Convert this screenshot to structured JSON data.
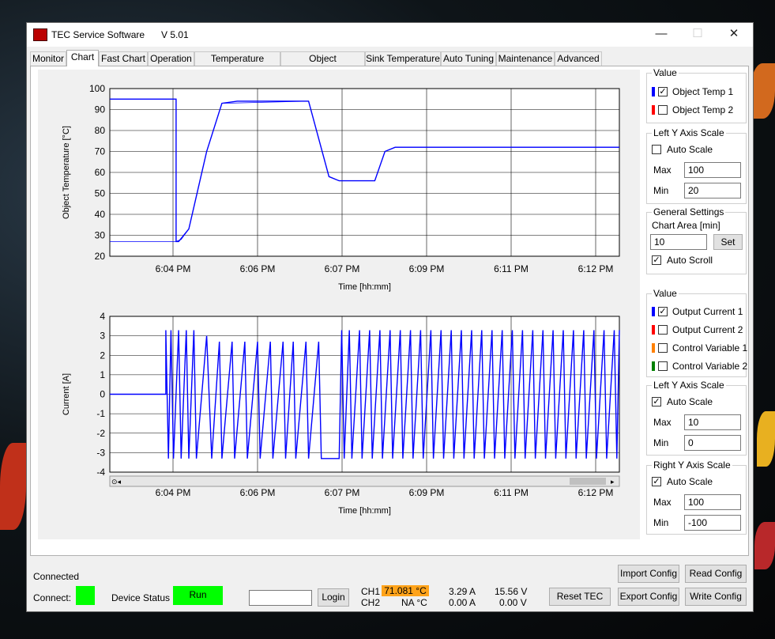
{
  "window": {
    "title": "TEC Service Software",
    "version": "V 5.01"
  },
  "tabs": [
    "Monitor",
    "Chart",
    "Fast Chart",
    "Operation",
    "Temperature Control",
    "Object Temperature",
    "Sink Temperature",
    "Auto Tuning",
    "Maintenance",
    "Advanced"
  ],
  "active_tab": "Chart",
  "panel_top": {
    "value_title": "Value",
    "series": [
      {
        "label": "Object Temp 1",
        "color": "#0000ff",
        "checked": true
      },
      {
        "label": "Object Temp 2",
        "color": "#ff0000",
        "checked": false
      }
    ],
    "left_axis": {
      "title": "Left Y Axis Scale",
      "auto_label": "Auto Scale",
      "auto": false,
      "max_label": "Max",
      "max": "100",
      "min_label": "Min",
      "min": "20"
    },
    "general": {
      "title": "General Settings",
      "area_label": "Chart Area [min]",
      "area": "10",
      "set_label": "Set",
      "autoscroll_label": "Auto Scroll",
      "autoscroll": true
    }
  },
  "panel_bottom": {
    "value_title": "Value",
    "series": [
      {
        "label": "Output Current 1",
        "color": "#0000ff",
        "checked": true
      },
      {
        "label": "Output Current 2",
        "color": "#ff0000",
        "checked": false
      },
      {
        "label": "Control Variable 1",
        "color": "#ff8000",
        "checked": false
      },
      {
        "label": "Control Variable 2",
        "color": "#008000",
        "checked": false
      }
    ],
    "left_axis": {
      "title": "Left Y Axis Scale",
      "auto_label": "Auto Scale",
      "auto": true,
      "max_label": "Max",
      "max": "10",
      "min_label": "Min",
      "min": "0"
    },
    "right_axis": {
      "title": "Right Y Axis Scale",
      "auto_label": "Auto Scale",
      "auto": true,
      "max_label": "Max",
      "max": "100",
      "min_label": "Min",
      "min": "-100"
    }
  },
  "status": {
    "connected": "Connected",
    "connect_label": "Connect:",
    "device_status_label": "Device Status",
    "device_status": "Run",
    "login_label": "Login",
    "ch1": "CH1",
    "ch1_temp": "71.081 °C",
    "ch1_current": "3.29 A",
    "ch1_voltage": "15.56 V",
    "ch2": "CH2",
    "ch2_temp": "NA °C",
    "ch2_current": "0.00 A",
    "ch2_voltage": "0.00 V",
    "buttons": {
      "reset": "Reset TEC",
      "import": "Import Config",
      "export": "Export Config",
      "read": "Read Config",
      "write": "Write Config"
    }
  },
  "chart_data": [
    {
      "type": "line",
      "title": "",
      "xlabel": "Time [hh:mm]",
      "ylabel": "Object Temperature [°C]",
      "x_ticks": [
        "6:04 PM",
        "6:06 PM",
        "6:07 PM",
        "6:09 PM",
        "6:11 PM",
        "6:12 PM"
      ],
      "y_ticks": [
        20,
        30,
        40,
        50,
        60,
        70,
        80,
        90,
        100
      ],
      "ylim": [
        20,
        100
      ],
      "xlim": [
        0,
        10
      ],
      "series": [
        {
          "color": "#0000ff",
          "points": [
            [
              0,
              95
            ],
            [
              1.3,
              95
            ],
            [
              1.3,
              27
            ],
            [
              1.35,
              27
            ],
            [
              1.55,
              33
            ],
            [
              1.9,
              70
            ],
            [
              2.2,
              93
            ],
            [
              2.5,
              94
            ],
            [
              3.0,
              94
            ],
            [
              3.5,
              94
            ],
            [
              3.9,
              94
            ],
            [
              4.3,
              58
            ],
            [
              4.5,
              56
            ],
            [
              4.9,
              56
            ],
            [
              5.2,
              56
            ],
            [
              5.4,
              70
            ],
            [
              5.6,
              72
            ],
            [
              6.5,
              72
            ],
            [
              7.5,
              72
            ],
            [
              8.5,
              72
            ],
            [
              9.5,
              72
            ],
            [
              10,
              72
            ]
          ]
        },
        {
          "color": "#0000ff",
          "points": [
            [
              0,
              27
            ],
            [
              1.3,
              27
            ],
            [
              1.4,
              28
            ],
            [
              1.55,
              33
            ],
            [
              1.9,
              70
            ],
            [
              2.2,
              93
            ],
            [
              3.9,
              94
            ],
            [
              4.3,
              58
            ],
            [
              4.5,
              56
            ],
            [
              5.2,
              56
            ],
            [
              5.4,
              70
            ],
            [
              5.6,
              72
            ],
            [
              10,
              72
            ]
          ]
        }
      ]
    },
    {
      "type": "line",
      "title": "",
      "xlabel": "Time [hh:mm]",
      "ylabel": "Current [A]",
      "x_ticks": [
        "6:04 PM",
        "6:06 PM",
        "6:07 PM",
        "6:09 PM",
        "6:11 PM",
        "6:12 PM"
      ],
      "y_ticks": [
        4,
        3,
        2,
        1,
        0,
        -1,
        -2,
        -3,
        -4
      ],
      "ylim": [
        -4,
        4
      ],
      "xlim": [
        0,
        10
      ],
      "series": [
        {
          "color": "#0000ff",
          "points": [
            [
              0,
              0
            ],
            [
              1.1,
              0
            ],
            [
              1.1,
              3.29
            ],
            [
              1.15,
              -3.3
            ],
            [
              1.2,
              3.29
            ],
            [
              1.25,
              -3.3
            ],
            [
              1.35,
              3.29
            ],
            [
              1.4,
              -3.3
            ],
            [
              1.5,
              3.29
            ],
            [
              1.55,
              -3.3
            ],
            [
              1.65,
              3.29
            ],
            [
              1.7,
              -3.3
            ],
            [
              1.9,
              3.0
            ],
            [
              2.0,
              -3.3
            ],
            [
              2.15,
              2.7
            ],
            [
              2.2,
              -3.3
            ],
            [
              2.4,
              2.7
            ],
            [
              2.45,
              -3.3
            ],
            [
              2.65,
              2.7
            ],
            [
              2.7,
              -3.3
            ],
            [
              2.9,
              2.7
            ],
            [
              2.95,
              -3.3
            ],
            [
              3.15,
              2.7
            ],
            [
              3.2,
              -3.3
            ],
            [
              3.4,
              2.7
            ],
            [
              3.45,
              -3.3
            ],
            [
              3.6,
              2.7
            ],
            [
              3.65,
              -3.3
            ],
            [
              3.85,
              2.7
            ],
            [
              3.9,
              -3.3
            ],
            [
              4.1,
              2.7
            ],
            [
              4.15,
              -3.3
            ],
            [
              4.5,
              -3.3
            ],
            [
              4.55,
              3.29
            ],
            [
              4.6,
              -3.3
            ],
            [
              4.7,
              3.29
            ],
            [
              4.75,
              -3.3
            ],
            [
              4.9,
              3.29
            ],
            [
              4.95,
              -3.3
            ],
            [
              5.1,
              3.29
            ],
            [
              5.15,
              -3.3
            ],
            [
              5.3,
              3.29
            ],
            [
              5.35,
              -3.3
            ],
            [
              5.5,
              3.29
            ],
            [
              5.55,
              -3.3
            ],
            [
              5.7,
              3.29
            ],
            [
              5.75,
              -3.3
            ],
            [
              5.9,
              3.29
            ],
            [
              5.95,
              -3.3
            ],
            [
              6.1,
              3.29
            ],
            [
              6.15,
              -3.3
            ],
            [
              6.3,
              3.29
            ],
            [
              6.35,
              -3.3
            ],
            [
              6.5,
              3.29
            ],
            [
              6.55,
              -3.3
            ],
            [
              6.7,
              3.29
            ],
            [
              6.75,
              -3.3
            ],
            [
              6.9,
              3.29
            ],
            [
              6.95,
              -3.3
            ],
            [
              7.1,
              3.29
            ],
            [
              7.15,
              -3.3
            ],
            [
              7.3,
              3.29
            ],
            [
              7.35,
              -3.3
            ],
            [
              7.5,
              3.29
            ],
            [
              7.55,
              -3.3
            ],
            [
              7.7,
              3.29
            ],
            [
              7.75,
              -3.3
            ],
            [
              7.9,
              3.29
            ],
            [
              7.95,
              -3.3
            ],
            [
              8.1,
              3.29
            ],
            [
              8.15,
              -3.3
            ],
            [
              8.3,
              3.29
            ],
            [
              8.35,
              -3.3
            ],
            [
              8.5,
              3.29
            ],
            [
              8.55,
              -3.3
            ],
            [
              8.7,
              3.29
            ],
            [
              8.75,
              -3.3
            ],
            [
              8.9,
              3.29
            ],
            [
              8.95,
              -3.3
            ],
            [
              9.1,
              3.29
            ],
            [
              9.15,
              -3.3
            ],
            [
              9.3,
              3.29
            ],
            [
              9.35,
              -3.3
            ],
            [
              9.5,
              3.29
            ],
            [
              9.55,
              -3.3
            ],
            [
              9.7,
              3.29
            ],
            [
              9.75,
              -3.3
            ],
            [
              9.9,
              3.29
            ],
            [
              9.95,
              -3.3
            ],
            [
              10,
              3.29
            ]
          ]
        }
      ]
    }
  ]
}
